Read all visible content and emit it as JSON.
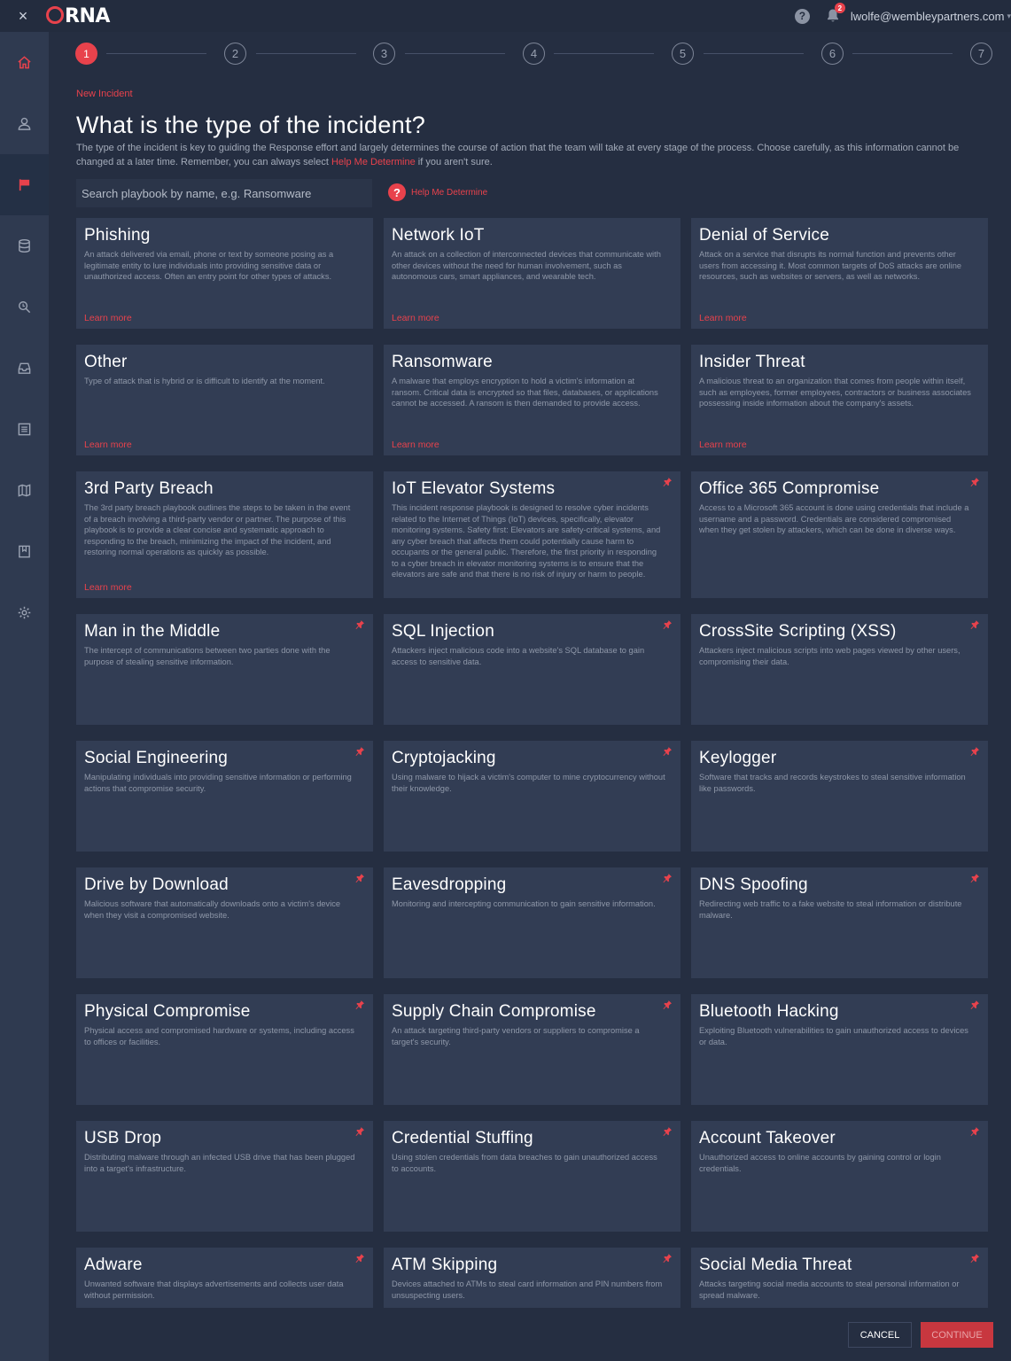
{
  "topbar": {
    "close_label": "×",
    "logo": "ORNA",
    "help_label": "?",
    "notifications_count": "2",
    "user_email": "lwolfe@wembleypartners.com",
    "user_caret": "▾"
  },
  "sidebar": {
    "items": [
      {
        "name": "home",
        "icon": "home-icon",
        "active": false
      },
      {
        "name": "user",
        "icon": "user-icon",
        "active": false
      },
      {
        "name": "incidents",
        "icon": "flag-icon",
        "active": true
      },
      {
        "name": "database",
        "icon": "database-icon",
        "active": false
      },
      {
        "name": "search",
        "icon": "search-icon",
        "active": false
      },
      {
        "name": "inbox",
        "icon": "inbox-icon",
        "active": false
      },
      {
        "name": "list",
        "icon": "list-icon",
        "active": false
      },
      {
        "name": "map",
        "icon": "map-icon",
        "active": false
      },
      {
        "name": "bookmark",
        "icon": "bookmark-icon",
        "active": false
      },
      {
        "name": "settings",
        "icon": "gear-icon",
        "active": false
      }
    ]
  },
  "stepper": {
    "steps": [
      "1",
      "2",
      "3",
      "4",
      "5",
      "6",
      "7"
    ],
    "current": 1
  },
  "breadcrumb": "New Incident",
  "title": "What is the type of the incident?",
  "description": {
    "before": "The type of the incident is key to guiding the Response effort and largely determines the course of action that the team will take at every stage of the process. Choose carefully, as this information cannot be changed at a later time. Remember, you can always select ",
    "link": "Help Me Determine",
    "after": " if you aren't sure."
  },
  "search": {
    "placeholder": "Search playbook by name, e.g. Ransomware",
    "value": ""
  },
  "help_determine": {
    "icon": "?",
    "label": "Help Me Determine"
  },
  "learn_more_label": "Learn more",
  "cards": [
    {
      "title": "Phishing",
      "desc": "An attack delivered via email, phone or text by someone posing as a legitimate entity to lure individuals into providing sensitive data or unauthorized access. Often an entry point for other types of attacks.",
      "learn": true,
      "pinned": false
    },
    {
      "title": "Network IoT",
      "desc": "An attack on a collection of interconnected devices that communicate with other devices without the need for human involvement, such as autonomous cars, smart appliances, and wearable tech.",
      "learn": true,
      "pinned": false
    },
    {
      "title": "Denial of Service",
      "desc": "Attack on a service that disrupts its normal function and prevents other users from accessing it. Most common targets of DoS attacks are online resources, such as websites or servers, as well as networks.",
      "learn": true,
      "pinned": false
    },
    {
      "title": "Other",
      "desc": "Type of attack that is hybrid or is difficult to identify at the moment.",
      "learn": true,
      "pinned": false
    },
    {
      "title": "Ransomware",
      "desc": "A malware that employs encryption to hold a victim's information at ransom. Critical data is encrypted so that files, databases, or applications cannot be accessed. A ransom is then demanded to provide access.",
      "learn": true,
      "pinned": false
    },
    {
      "title": "Insider Threat",
      "desc": "A malicious threat to an organization that comes from people within itself, such as employees, former employees, contractors or business associates possessing inside information about the company's assets.",
      "learn": true,
      "pinned": false
    },
    {
      "title": "3rd Party Breach",
      "desc": "The 3rd party breach playbook outlines the steps to be taken in the event of a breach involving a third-party vendor or partner. The purpose of this playbook is to provide a clear concise and systematic approach to responding to the breach, minimizing the impact of the incident, and restoring normal operations as quickly as possible.",
      "learn": true,
      "pinned": false
    },
    {
      "title": "IoT Elevator Systems",
      "desc": "This incident response playbook is designed to resolve cyber incidents related to the Internet of Things (IoT) devices, specifically, elevator monitoring systems. Safety first: Elevators are safety-critical systems, and any cyber breach that affects them could potentially cause harm to occupants or the general public. Therefore, the first priority in responding to a cyber breach in elevator monitoring systems is to ensure that the elevators are safe and that there is no risk of injury or harm to people.",
      "learn": false,
      "pinned": true
    },
    {
      "title": "Office 365 Compromise",
      "desc": "Access to a Microsoft 365 account is done using credentials that include a username and a password. Credentials are considered compromised when they get stolen by attackers, which can be done in diverse ways.",
      "learn": false,
      "pinned": true
    },
    {
      "title": "Man in the Middle",
      "desc": "The intercept of communications between two parties done with the purpose of stealing sensitive information.",
      "learn": false,
      "pinned": true
    },
    {
      "title": "SQL Injection",
      "desc": "Attackers inject malicious code into a website's SQL database to gain access to sensitive data.",
      "learn": false,
      "pinned": true
    },
    {
      "title": "CrossSite Scripting (XSS)",
      "desc": "Attackers inject malicious scripts into web pages viewed by other users, compromising their data.",
      "learn": false,
      "pinned": true
    },
    {
      "title": "Social Engineering",
      "desc": "Manipulating individuals into providing sensitive information or performing actions that compromise security.",
      "learn": false,
      "pinned": true
    },
    {
      "title": "Cryptojacking",
      "desc": "Using malware to hijack a victim's computer to mine cryptocurrency without their knowledge.",
      "learn": false,
      "pinned": true
    },
    {
      "title": "Keylogger",
      "desc": "Software that tracks and records keystrokes to steal sensitive information like passwords.",
      "learn": false,
      "pinned": true
    },
    {
      "title": "Drive by Download",
      "desc": "Malicious software that automatically downloads onto a victim's device when they visit a compromised website.",
      "learn": false,
      "pinned": true
    },
    {
      "title": "Eavesdropping",
      "desc": "Monitoring and intercepting communication to gain sensitive information.",
      "learn": false,
      "pinned": true
    },
    {
      "title": "DNS Spoofing",
      "desc": "Redirecting web traffic to a fake website to steal information or distribute malware.",
      "learn": false,
      "pinned": true
    },
    {
      "title": "Physical Compromise",
      "desc": "Physical access and compromised hardware or systems, including access to offices or facilities.",
      "learn": false,
      "pinned": true
    },
    {
      "title": "Supply Chain Compromise",
      "desc": "An attack targeting third-party vendors or suppliers to compromise a target's security.",
      "learn": false,
      "pinned": true
    },
    {
      "title": "Bluetooth Hacking",
      "desc": "Exploiting Bluetooth vulnerabilities to gain unauthorized access to devices or data.",
      "learn": false,
      "pinned": true
    },
    {
      "title": "USB Drop",
      "desc": "Distributing malware through an infected USB drive that has been plugged into a target's infrastructure.",
      "learn": false,
      "pinned": true
    },
    {
      "title": "Credential Stuffing",
      "desc": "Using stolen credentials from data breaches to gain unauthorized access to accounts.",
      "learn": false,
      "pinned": true
    },
    {
      "title": "Account Takeover",
      "desc": "Unauthorized access to online accounts by gaining control or login credentials.",
      "learn": false,
      "pinned": true
    },
    {
      "title": "Adware",
      "desc": "Unwanted software that displays advertisements and collects user data without permission.",
      "learn": false,
      "pinned": true
    },
    {
      "title": "ATM Skipping",
      "desc": "Devices attached to ATMs to steal card information and PIN numbers from unsuspecting users.",
      "learn": false,
      "pinned": true
    },
    {
      "title": "Social Media Threat",
      "desc": "Attacks targeting social media accounts to steal personal information or spread malware.",
      "learn": false,
      "pinned": true
    }
  ],
  "footer": {
    "cancel_label": "CANCEL",
    "continue_label": "CONTINUE"
  },
  "colors": {
    "accent": "#e8424c",
    "background": "#252e41",
    "card": "#323d54",
    "sidebar": "#2f3a50"
  }
}
